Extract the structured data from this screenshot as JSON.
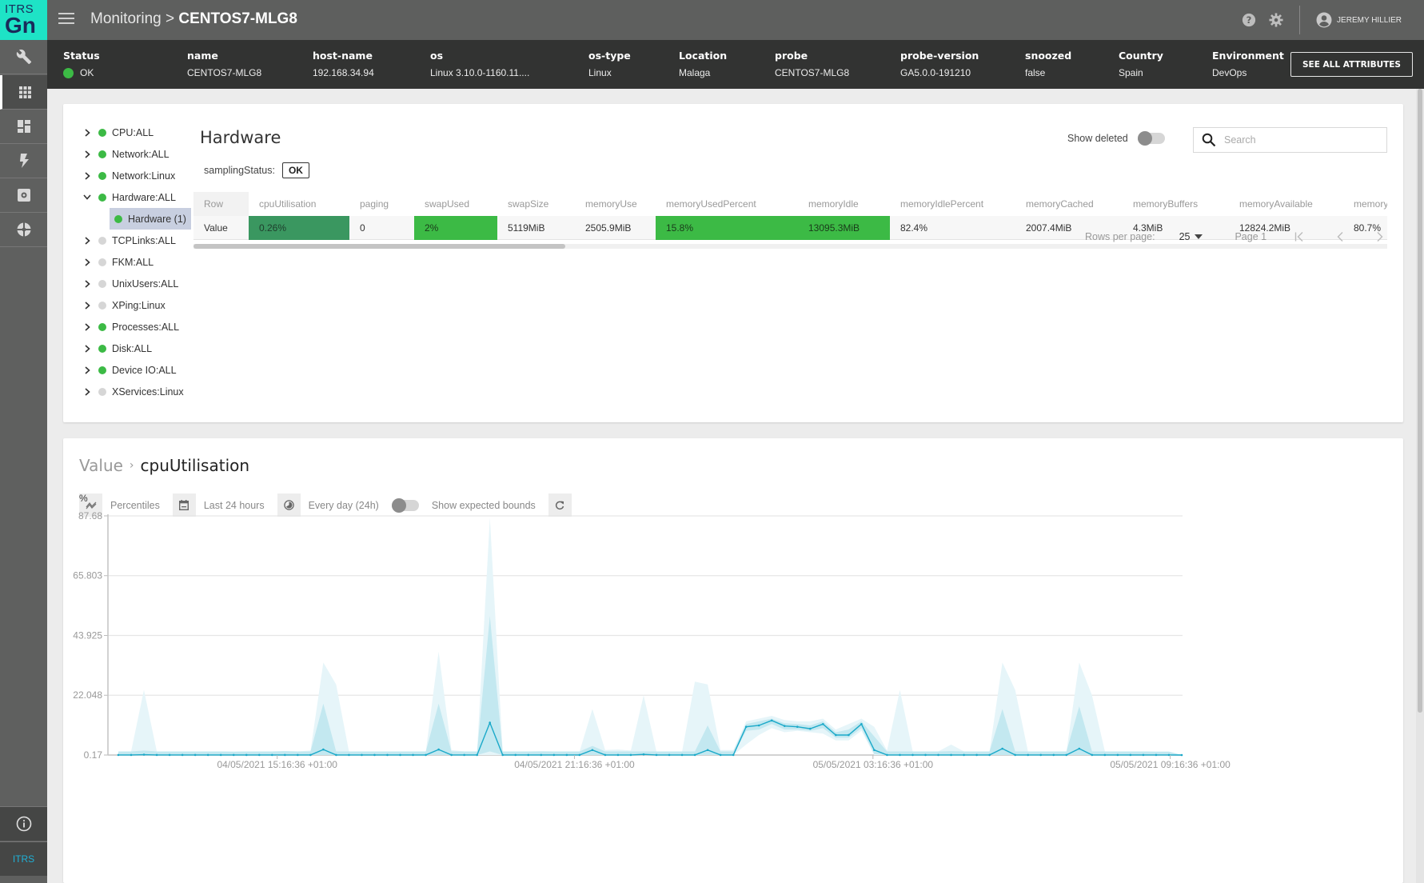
{
  "app": {
    "logo_top": "ITRS",
    "logo_bottom": "Gn",
    "rail_footer": "ITRS"
  },
  "rail": {
    "items": [
      {
        "icon": "wrench-icon",
        "active": false
      },
      {
        "icon": "grid-icon",
        "active": true
      },
      {
        "icon": "dashboard-icon",
        "active": false
      },
      {
        "icon": "lightning-icon",
        "active": false
      },
      {
        "icon": "gear-box-icon",
        "active": false
      },
      {
        "icon": "pie-icon",
        "active": false
      }
    ],
    "bottom_icon": "info-icon"
  },
  "header": {
    "breadcrumb_parent": "Monitoring",
    "breadcrumb_sep": ">",
    "breadcrumb_current": "CENTOS7-MLG8",
    "user_name": "JEREMY HILLIER",
    "icons": [
      "help-icon",
      "settings-icon",
      "user-avatar-icon"
    ]
  },
  "attributes": {
    "items": [
      {
        "key": "Status",
        "value": "OK",
        "status_color": "#3cba45"
      },
      {
        "key": "name",
        "value": "CENTOS7-MLG8"
      },
      {
        "key": "host-name",
        "value": "192.168.34.94"
      },
      {
        "key": "os",
        "value": "Linux 3.10.0-1160.11...."
      },
      {
        "key": "os-type",
        "value": "Linux"
      },
      {
        "key": "Location",
        "value": "Malaga"
      },
      {
        "key": "probe",
        "value": "CENTOS7-MLG8"
      },
      {
        "key": "probe-version",
        "value": "GA5.0.0-191210"
      },
      {
        "key": "snoozed",
        "value": "false"
      },
      {
        "key": "Country",
        "value": "Spain"
      },
      {
        "key": "Environment",
        "value": "DevOps"
      }
    ],
    "see_all_label": "SEE ALL ATTRIBUTES"
  },
  "tree": {
    "items": [
      {
        "label": "CPU:ALL",
        "status": "ok",
        "expanded": false
      },
      {
        "label": "Network:ALL",
        "status": "ok",
        "expanded": false
      },
      {
        "label": "Network:Linux",
        "status": "ok",
        "expanded": false
      },
      {
        "label": "Hardware:ALL",
        "status": "ok",
        "expanded": true,
        "children": [
          {
            "label": "Hardware (1)",
            "status": "ok",
            "selected": true
          }
        ]
      },
      {
        "label": "TCPLinks:ALL",
        "status": "none",
        "expanded": false
      },
      {
        "label": "FKM:ALL",
        "status": "none",
        "expanded": false
      },
      {
        "label": "UnixUsers:ALL",
        "status": "none",
        "expanded": false
      },
      {
        "label": "XPing:Linux",
        "status": "none",
        "expanded": false
      },
      {
        "label": "Processes:ALL",
        "status": "ok",
        "expanded": false
      },
      {
        "label": "Disk:ALL",
        "status": "ok",
        "expanded": false
      },
      {
        "label": "Device IO:ALL",
        "status": "ok",
        "expanded": false
      },
      {
        "label": "XServices:Linux",
        "status": "none",
        "expanded": false
      }
    ],
    "colors": {
      "ok": "#3cba45",
      "none": "#d6d6d6"
    }
  },
  "dataview": {
    "title": "Hardware",
    "sampling_label": "samplingStatus:",
    "sampling_value": "OK",
    "show_deleted_label": "Show deleted",
    "show_deleted": false,
    "search_placeholder": "Search",
    "search_value": "",
    "columns": [
      "Row",
      "cpuUtilisation",
      "paging",
      "swapUsed",
      "swapSize",
      "memoryUse",
      "memoryUsedPercent",
      "memoryIdle",
      "memoryIdlePercent",
      "memoryCached",
      "memoryBuffers",
      "memoryAvailable",
      "memory."
    ],
    "row": [
      "Value",
      "0.26%",
      "0",
      "2%",
      "5119MiB",
      "2505.9MiB",
      "15.8%",
      "13095.3MiB",
      "82.4%",
      "2007.4MiB",
      "4.3MiB",
      "12824.2MiB",
      "80.7%"
    ],
    "cell_highlight": [
      "",
      "dark-green",
      "",
      "green",
      "",
      "",
      "green",
      "green",
      "",
      "",
      "",
      "",
      ""
    ],
    "highlight_colors": {
      "dark-green": "#3a9760",
      "green": "#3cba45"
    },
    "pager": {
      "rows_per_page_label": "Rows per page:",
      "rows_per_page": "25",
      "page_label": "Page 1"
    }
  },
  "chart_panel": {
    "breadcrumb_parent": "Value",
    "breadcrumb_current": "cpuUtilisation",
    "toolbar": {
      "percentiles_label": "Percentiles",
      "range_label": "Last 24 hours",
      "period_label": "Every day (24h)",
      "bounds_label": "Show expected bounds",
      "show_bounds": false
    }
  },
  "chart_data": {
    "type": "area",
    "title": "cpuUtilisation",
    "ylabel": "%",
    "xlabel": "",
    "ylim": [
      0.17,
      87.68
    ],
    "yticks": [
      0.17,
      22.048,
      43.925,
      65.803,
      87.68
    ],
    "ytick_labels": [
      "0.17",
      "22.048",
      "43.925",
      "65.803",
      "87.68"
    ],
    "xtick_labels": [
      "04/05/2021 15:16:36 +01:00",
      "04/05/2021 21:16:36 +01:00",
      "05/05/2021 03:16:36 +01:00",
      "05/05/2021 09:16:36 +01:00"
    ],
    "xtick_index": [
      12.4,
      35.6,
      58.9,
      82.1
    ],
    "grid": true,
    "interval_minutes": 15,
    "colors": {
      "line": "#1ba9c9",
      "inner_band": "#c3e8f0",
      "outer_band": "#e6f5f9"
    },
    "series": [
      {
        "name": "median",
        "values": [
          0.2,
          0.2,
          0.3,
          0.2,
          0.2,
          0.2,
          0.2,
          0.2,
          0.2,
          0.2,
          0.2,
          0.2,
          0.2,
          0.2,
          0.2,
          0.2,
          0.2,
          0.2,
          0.2,
          0.2,
          0.2,
          0.2,
          0.2,
          0.2,
          0.2,
          0.2,
          0.2,
          0.2,
          0.2,
          0.2,
          0.2,
          0.2,
          0.2,
          0.2,
          0.2,
          0.2,
          0.2,
          0.2,
          0.2,
          0.2,
          0.2,
          0.2,
          0.2,
          0.2,
          2.0,
          0.2,
          0.2,
          0.2,
          0.2,
          0.2,
          0.2,
          0.2,
          0.3,
          0.2,
          0.2,
          0.2,
          0.2,
          0.2,
          0.2,
          0.2,
          0.2,
          0.2,
          0.2,
          0.2,
          0.2,
          0.2,
          0.2,
          0.2,
          0.2,
          0.2,
          0.2,
          0.2,
          0.2,
          0.2,
          0.2,
          0.2,
          0.2,
          0.2,
          0.2,
          0.2,
          0.2,
          0.2,
          0.2,
          0.2
        ]
      },
      {
        "name": "p25",
        "values": []
      },
      {
        "name": "p75",
        "values": []
      },
      {
        "name": "p5",
        "values": []
      },
      {
        "name": "p95",
        "values": []
      }
    ],
    "points": [
      {
        "m": 0.2,
        "lo": 0.17,
        "hi": 1.5,
        "olo": 0.17,
        "ohi": 1.5
      },
      {
        "m": 0.2,
        "lo": 0.17,
        "hi": 1.5,
        "olo": 0.17,
        "ohi": 1.5
      },
      {
        "m": 0.3,
        "lo": 0.17,
        "hi": 1.8,
        "olo": 0.17,
        "ohi": 24.0
      },
      {
        "m": 0.2,
        "lo": 0.17,
        "hi": 1.5,
        "olo": 0.17,
        "ohi": 1.5
      },
      {
        "m": 0.2,
        "lo": 0.17,
        "hi": 1.5,
        "olo": 0.17,
        "ohi": 1.5
      },
      {
        "m": 0.2,
        "lo": 0.17,
        "hi": 1.5,
        "olo": 0.17,
        "ohi": 1.5
      },
      {
        "m": 0.2,
        "lo": 0.17,
        "hi": 1.5,
        "olo": 0.17,
        "ohi": 1.5
      },
      {
        "m": 0.2,
        "lo": 0.17,
        "hi": 1.5,
        "olo": 0.17,
        "ohi": 1.5
      },
      {
        "m": 0.2,
        "lo": 0.17,
        "hi": 1.5,
        "olo": 0.17,
        "ohi": 1.5
      },
      {
        "m": 0.2,
        "lo": 0.17,
        "hi": 1.4,
        "olo": 0.17,
        "ohi": 1.4
      },
      {
        "m": 0.2,
        "lo": 0.17,
        "hi": 1.5,
        "olo": 0.17,
        "ohi": 1.5
      },
      {
        "m": 0.2,
        "lo": 0.17,
        "hi": 1.5,
        "olo": 0.17,
        "ohi": 1.5
      },
      {
        "m": 0.2,
        "lo": 0.17,
        "hi": 1.5,
        "olo": 0.17,
        "ohi": 1.5
      },
      {
        "m": 0.2,
        "lo": 0.17,
        "hi": 1.6,
        "olo": 0.17,
        "ohi": 1.6
      },
      {
        "m": 0.2,
        "lo": 0.17,
        "hi": 1.5,
        "olo": 0.17,
        "ohi": 1.5
      },
      {
        "m": 0.2,
        "lo": 0.17,
        "hi": 1.5,
        "olo": 0.17,
        "ohi": 1.8
      },
      {
        "m": 2.2,
        "lo": 0.17,
        "hi": 19.0,
        "olo": 0.17,
        "ohi": 34.0
      },
      {
        "m": 0.2,
        "lo": 0.17,
        "hi": 1.5,
        "olo": 0.17,
        "ohi": 26.0
      },
      {
        "m": 0.2,
        "lo": 0.17,
        "hi": 1.5,
        "olo": 0.17,
        "ohi": 1.5
      },
      {
        "m": 0.2,
        "lo": 0.17,
        "hi": 1.5,
        "olo": 0.17,
        "ohi": 1.5
      },
      {
        "m": 0.2,
        "lo": 0.17,
        "hi": 1.5,
        "olo": 0.17,
        "ohi": 1.5
      },
      {
        "m": 0.2,
        "lo": 0.17,
        "hi": 1.5,
        "olo": 0.17,
        "ohi": 1.5
      },
      {
        "m": 0.2,
        "lo": 0.17,
        "hi": 1.5,
        "olo": 0.17,
        "ohi": 1.5
      },
      {
        "m": 0.2,
        "lo": 0.17,
        "hi": 1.5,
        "olo": 0.17,
        "ohi": 1.5
      },
      {
        "m": 0.2,
        "lo": 0.17,
        "hi": 1.5,
        "olo": 0.17,
        "ohi": 1.5
      },
      {
        "m": 2.2,
        "lo": 0.17,
        "hi": 19.0,
        "olo": 0.17,
        "ohi": 38.0
      },
      {
        "m": 0.2,
        "lo": 0.17,
        "hi": 1.5,
        "olo": 0.17,
        "ohi": 2.0
      },
      {
        "m": 0.2,
        "lo": 0.17,
        "hi": 1.5,
        "olo": 0.17,
        "ohi": 1.5
      },
      {
        "m": 0.2,
        "lo": 0.17,
        "hi": 1.5,
        "olo": 0.17,
        "ohi": 1.5
      },
      {
        "m": 12.0,
        "lo": 1.5,
        "hi": 51.0,
        "olo": 0.17,
        "ohi": 87.0
      },
      {
        "m": 0.2,
        "lo": 0.17,
        "hi": 1.5,
        "olo": 0.17,
        "ohi": 1.5
      },
      {
        "m": 0.2,
        "lo": 0.17,
        "hi": 1.5,
        "olo": 0.17,
        "ohi": 1.5
      },
      {
        "m": 0.2,
        "lo": 0.17,
        "hi": 1.5,
        "olo": 0.17,
        "ohi": 1.5
      },
      {
        "m": 0.2,
        "lo": 0.17,
        "hi": 1.5,
        "olo": 0.17,
        "ohi": 1.6
      },
      {
        "m": 0.2,
        "lo": 0.17,
        "hi": 1.5,
        "olo": 0.17,
        "ohi": 1.5
      },
      {
        "m": 0.2,
        "lo": 0.17,
        "hi": 1.5,
        "olo": 0.17,
        "ohi": 1.5
      },
      {
        "m": 0.2,
        "lo": 0.17,
        "hi": 1.5,
        "olo": 0.17,
        "ohi": 1.5
      },
      {
        "m": 2.0,
        "lo": 0.17,
        "hi": 3.5,
        "olo": 0.17,
        "ohi": 17.0
      },
      {
        "m": 0.2,
        "lo": 0.17,
        "hi": 1.5,
        "olo": 0.17,
        "ohi": 2.0
      },
      {
        "m": 0.2,
        "lo": 0.17,
        "hi": 1.5,
        "olo": 0.17,
        "ohi": 2.2
      },
      {
        "m": 0.2,
        "lo": 0.17,
        "hi": 1.5,
        "olo": 0.17,
        "ohi": 1.8
      },
      {
        "m": 0.4,
        "lo": 0.17,
        "hi": 1.5,
        "olo": 0.17,
        "ohi": 22.0
      },
      {
        "m": 0.2,
        "lo": 0.17,
        "hi": 1.5,
        "olo": 0.17,
        "ohi": 1.5
      },
      {
        "m": 0.2,
        "lo": 0.17,
        "hi": 1.5,
        "olo": 0.17,
        "ohi": 1.5
      },
      {
        "m": 0.2,
        "lo": 0.17,
        "hi": 1.5,
        "olo": 0.17,
        "ohi": 1.5
      },
      {
        "m": 0.2,
        "lo": 0.17,
        "hi": 1.5,
        "olo": 0.17,
        "ohi": 27.0
      },
      {
        "m": 2.0,
        "lo": 0.17,
        "hi": 11.0,
        "olo": 0.17,
        "ohi": 26.0
      },
      {
        "m": 0.2,
        "lo": 0.17,
        "hi": 1.5,
        "olo": 0.17,
        "ohi": 2.0
      },
      {
        "m": 0.2,
        "lo": 0.17,
        "hi": 1.5,
        "olo": 0.17,
        "ohi": 2.0
      },
      {
        "m": 10.5,
        "lo": 9.0,
        "hi": 11.5,
        "olo": 4.0,
        "ohi": 12.5
      },
      {
        "m": 11.0,
        "lo": 9.5,
        "hi": 12.5,
        "olo": 7.5,
        "ohi": 13.5
      },
      {
        "m": 12.8,
        "lo": 11.5,
        "hi": 13.5,
        "olo": 10.0,
        "ohi": 14.5
      },
      {
        "m": 10.8,
        "lo": 9.5,
        "hi": 11.8,
        "olo": 8.5,
        "ohi": 13.0
      },
      {
        "m": 10.5,
        "lo": 9.5,
        "hi": 11.5,
        "olo": 9.0,
        "ohi": 12.5
      },
      {
        "m": 9.8,
        "lo": 9.0,
        "hi": 11.0,
        "olo": 8.5,
        "ohi": 12.5
      },
      {
        "m": 11.5,
        "lo": 10.0,
        "hi": 12.5,
        "olo": 8.0,
        "ohi": 13.5
      },
      {
        "m": 7.5,
        "lo": 6.5,
        "hi": 8.5,
        "olo": 5.5,
        "ohi": 9.5
      },
      {
        "m": 7.5,
        "lo": 6.5,
        "hi": 9.5,
        "olo": 5.5,
        "ohi": 11.5
      },
      {
        "m": 11.5,
        "lo": 10.0,
        "hi": 12.5,
        "olo": 9.0,
        "ohi": 13.5
      },
      {
        "m": 2.0,
        "lo": 0.5,
        "hi": 7.0,
        "olo": 0.17,
        "ohi": 10.5
      },
      {
        "m": 0.2,
        "lo": 0.17,
        "hi": 1.5,
        "olo": 0.17,
        "ohi": 1.8
      },
      {
        "m": 0.2,
        "lo": 0.17,
        "hi": 1.5,
        "olo": 0.17,
        "ohi": 24.0
      },
      {
        "m": 0.2,
        "lo": 0.17,
        "hi": 1.5,
        "olo": 0.17,
        "ohi": 1.5
      },
      {
        "m": 0.2,
        "lo": 0.17,
        "hi": 1.5,
        "olo": 0.17,
        "ohi": 1.5
      },
      {
        "m": 0.2,
        "lo": 0.17,
        "hi": 1.5,
        "olo": 0.17,
        "ohi": 1.5
      },
      {
        "m": 0.2,
        "lo": 0.17,
        "hi": 1.6,
        "olo": 0.17,
        "ohi": 4.0
      },
      {
        "m": 0.2,
        "lo": 0.17,
        "hi": 1.5,
        "olo": 0.17,
        "ohi": 1.5
      },
      {
        "m": 0.2,
        "lo": 0.17,
        "hi": 1.5,
        "olo": 0.17,
        "ohi": 1.5
      },
      {
        "m": 0.2,
        "lo": 0.17,
        "hi": 1.5,
        "olo": 0.17,
        "ohi": 1.5
      },
      {
        "m": 2.5,
        "lo": 0.17,
        "hi": 17.0,
        "olo": 0.17,
        "ohi": 34.0
      },
      {
        "m": 0.2,
        "lo": 0.17,
        "hi": 1.5,
        "olo": 0.17,
        "ohi": 24.0
      },
      {
        "m": 0.2,
        "lo": 0.17,
        "hi": 1.5,
        "olo": 0.17,
        "ohi": 1.5
      },
      {
        "m": 0.2,
        "lo": 0.17,
        "hi": 1.5,
        "olo": 0.17,
        "ohi": 1.5
      },
      {
        "m": 0.2,
        "lo": 0.17,
        "hi": 1.5,
        "olo": 0.17,
        "ohi": 1.5
      },
      {
        "m": 0.2,
        "lo": 0.17,
        "hi": 1.5,
        "olo": 0.17,
        "ohi": 1.5
      },
      {
        "m": 2.5,
        "lo": 0.17,
        "hi": 18.0,
        "olo": 0.17,
        "ohi": 34.0
      },
      {
        "m": 0.2,
        "lo": 0.17,
        "hi": 1.5,
        "olo": 0.17,
        "ohi": 22.0
      },
      {
        "m": 0.2,
        "lo": 0.17,
        "hi": 1.5,
        "olo": 0.17,
        "ohi": 1.5
      },
      {
        "m": 0.2,
        "lo": 0.17,
        "hi": 1.5,
        "olo": 0.17,
        "ohi": 1.5
      },
      {
        "m": 0.2,
        "lo": 0.17,
        "hi": 1.5,
        "olo": 0.17,
        "ohi": 1.5
      },
      {
        "m": 0.2,
        "lo": 0.17,
        "hi": 1.5,
        "olo": 0.17,
        "ohi": 1.5
      },
      {
        "m": 0.2,
        "lo": 0.17,
        "hi": 1.4,
        "olo": 0.17,
        "ohi": 1.4
      },
      {
        "m": 0.2,
        "lo": 0.17,
        "hi": 1.4,
        "olo": 0.17,
        "ohi": 1.4
      },
      {
        "m": 0.17,
        "lo": 0.17,
        "hi": 0.17,
        "olo": 0.17,
        "ohi": 0.17
      }
    ]
  }
}
